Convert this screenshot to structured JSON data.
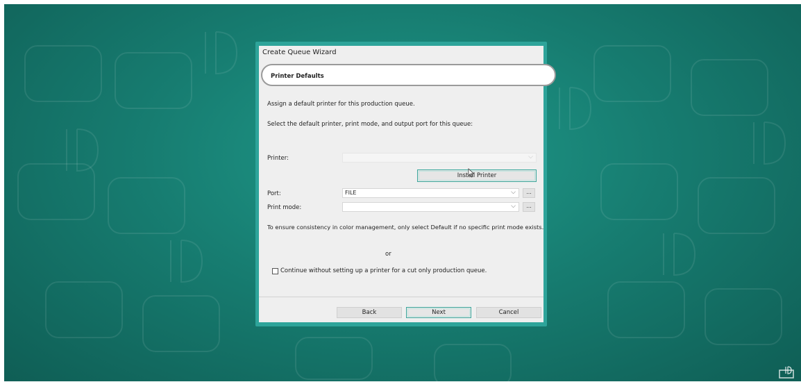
{
  "wizard": {
    "title": "Create Queue Wizard",
    "section_title": "Printer Defaults",
    "intro": "Assign a default printer for this production queue.",
    "instruction": "Select the default printer, print mode, and output port for this queue:",
    "printer": {
      "label": "Printer:",
      "value": ""
    },
    "install_printer_label": "Install Printer",
    "port": {
      "label": "Port:",
      "value": "FILE",
      "browse": "..."
    },
    "print_mode": {
      "label": "Print mode:",
      "value": "",
      "browse": "..."
    },
    "note": "To ensure consistency in color management, only select Default if no specific print mode exists.",
    "or_text": "or",
    "skip_checkbox": {
      "label": "Continue without setting up a printer for a cut only production queue.",
      "checked": false
    },
    "buttons": {
      "back": "Back",
      "next": "Next",
      "cancel": "Cancel"
    }
  },
  "colors": {
    "background": "#177d71",
    "wizard_border": "#2ea49a",
    "dialog": "#efefef"
  }
}
